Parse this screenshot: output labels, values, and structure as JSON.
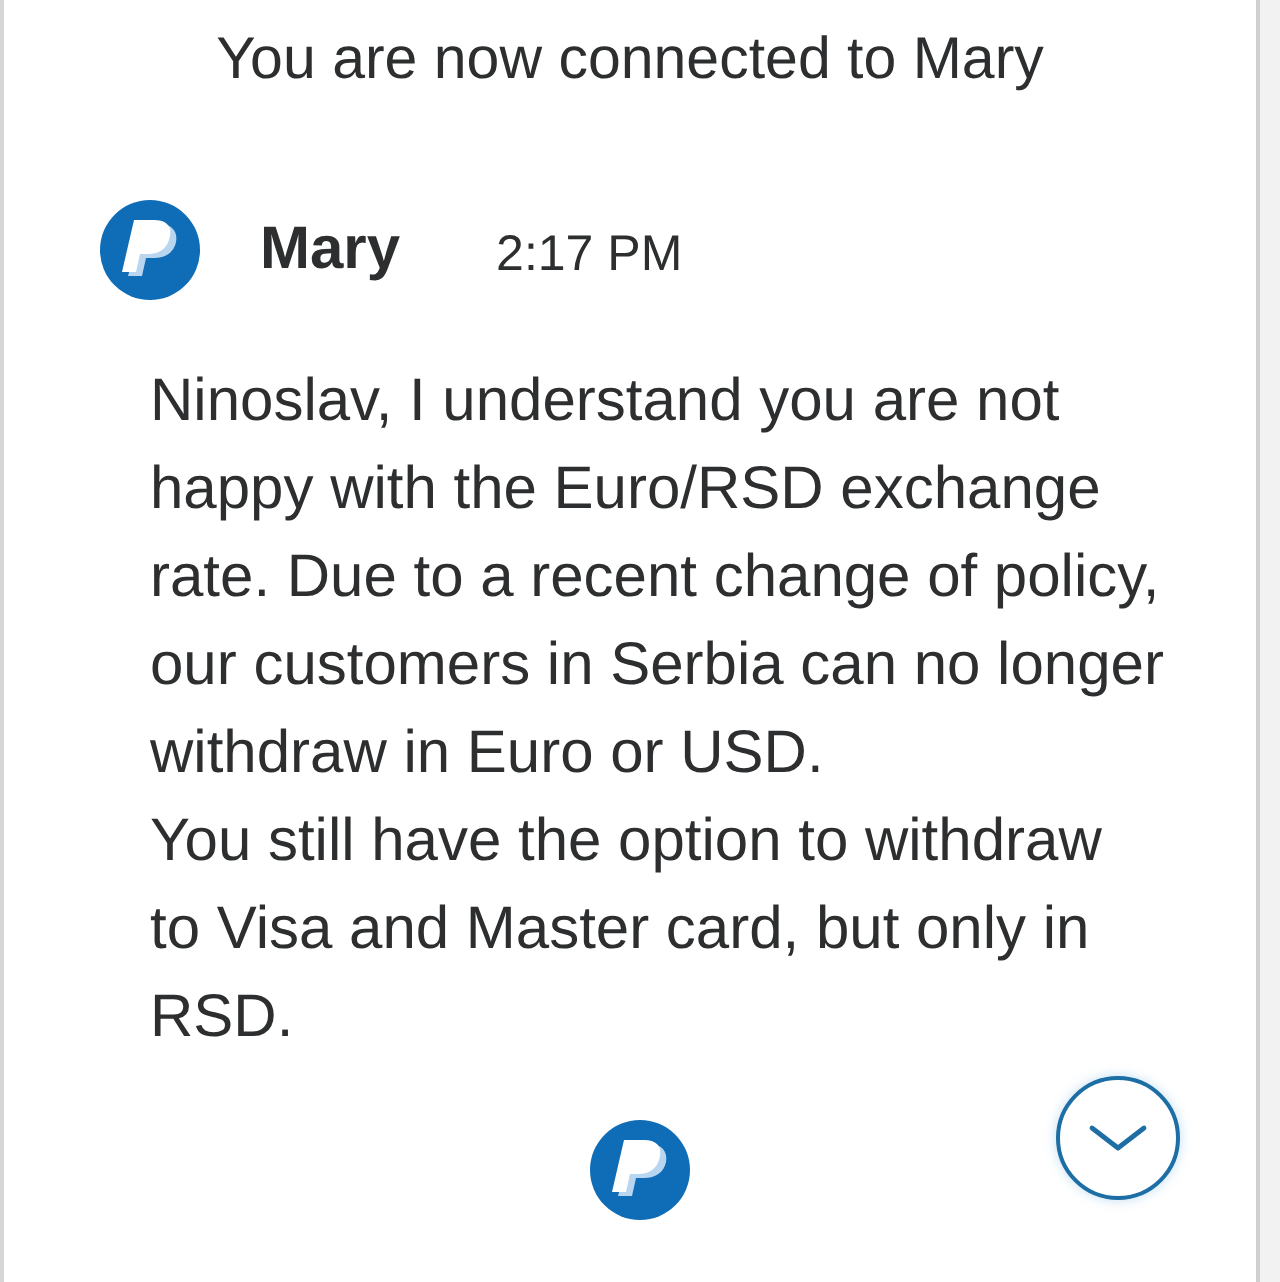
{
  "system_message": "You are now connected to Mary",
  "message": {
    "sender": "Mary",
    "time": "2:17 PM",
    "paragraphs": [
      "Ninoslav, I understand you are not happy with the Euro/RSD exchange rate. Due to a recent change of policy, our customers in Serbia can no longer withdraw in Euro or USD.",
      "You still have the option to withdraw to Visa and Master card, but only in RSD."
    ]
  }
}
